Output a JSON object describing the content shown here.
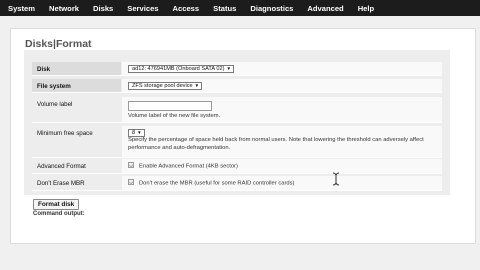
{
  "menu": [
    "System",
    "Network",
    "Disks",
    "Services",
    "Access",
    "Status",
    "Diagnostics",
    "Advanced",
    "Help"
  ],
  "page": {
    "title": "Disks|Format"
  },
  "form": {
    "disk": {
      "label": "Disk",
      "selected": "ad12: 476941MB (Onboard SATA 02)"
    },
    "filesystem": {
      "label": "File system",
      "selected": "ZFS storage pool device"
    },
    "volume_label": {
      "label": "Volume label",
      "value": "",
      "hint": "Volume label of the new file system."
    },
    "minfree": {
      "label": "Minimum free space",
      "selected": "8",
      "hint": "Specify the percentage of space held back from normal users. Note that lowering the threshold can adversely affect performance and auto-defragmentation."
    },
    "advanced_format": {
      "label": "Advanced Format",
      "checkbox_label": "Enable Advanced Format (4KB sector)",
      "checked": false
    },
    "dont_erase_mbr": {
      "label": "Don't Erase MBR",
      "checkbox_label": "Don't erase the MBR (useful for some RAID controller cards)",
      "checked": false
    }
  },
  "actions": {
    "format_button": "Format disk",
    "command_output_label": "Command output:"
  },
  "colors": {
    "menubar_bg": "#1c1c1c",
    "label_shade": "#dcdcdc",
    "form_bg": "#ededed"
  },
  "icons": {
    "cursor": "text-cursor-icon"
  }
}
